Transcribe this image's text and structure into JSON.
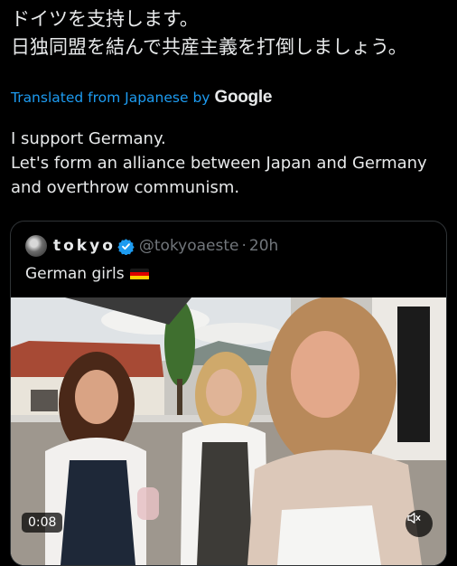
{
  "post": {
    "japanese_text": "ドイツを支持します。\n日独同盟を結んで共産主義を打倒しましょう。",
    "translation_label": "Translated from Japanese by",
    "translation_brand": "Google",
    "translated_text": "I support Germany.\nLet's form an alliance between Japan and Germany and overthrow communism."
  },
  "quoted_post": {
    "display_name": "tokyo",
    "handle": "@tokyoaeste",
    "separator": "·",
    "time": "20h",
    "text": "German girls",
    "flag_icon": "germany-flag-icon",
    "verified_icon": "verified-badge-icon",
    "media": {
      "type": "video",
      "duration": "0:08",
      "mute_icon": "speaker-muted-icon"
    }
  },
  "colors": {
    "background": "#000000",
    "text": "#e7e9ea",
    "secondary_text": "#71767b",
    "link": "#1d9bf0",
    "border": "#2f3336"
  }
}
